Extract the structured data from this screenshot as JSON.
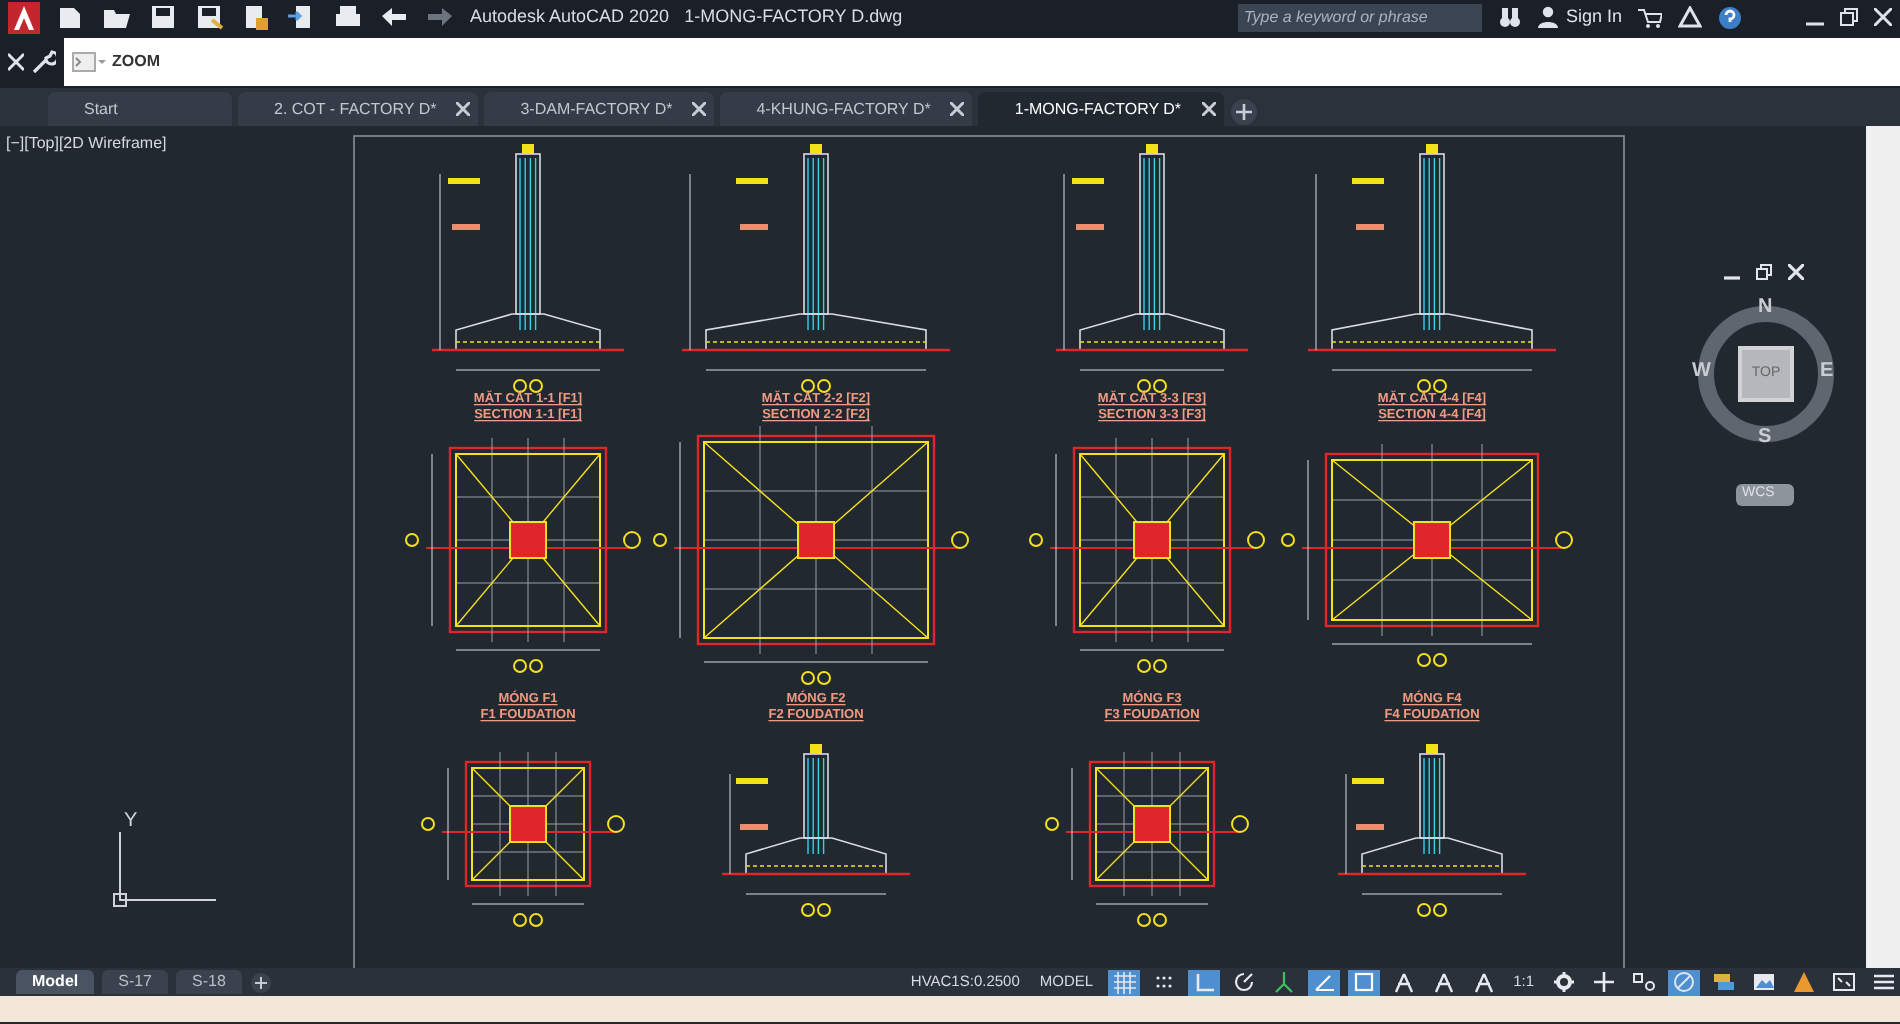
{
  "title_bar": {
    "app_name": "Autodesk AutoCAD 2020",
    "file_name": "1-MONG-FACTORY D.dwg",
    "search": {
      "placeholder": "Type a keyword or phrase"
    },
    "sign_in": "Sign In"
  },
  "command_line": {
    "value": "ZOOM"
  },
  "file_tabs": [
    {
      "label": "Start",
      "selected": false,
      "closable": false
    },
    {
      "label": "2. COT - FACTORY D*",
      "selected": false,
      "closable": true
    },
    {
      "label": "3-DAM-FACTORY D*",
      "selected": false,
      "closable": true
    },
    {
      "label": "4-KHUNG-FACTORY D*",
      "selected": false,
      "closable": true
    },
    {
      "label": "1-MONG-FACTORY D*",
      "selected": true,
      "closable": true
    }
  ],
  "viewport": {
    "label": "[−][Top][2D Wireframe]",
    "ucs_axis": "Y"
  },
  "viewcube": {
    "north": "N",
    "south": "S",
    "east": "E",
    "west": "W",
    "face": "TOP",
    "coordinate_system": "WCS"
  },
  "drawing": {
    "sections": [
      {
        "title": "MẶT CẮT 1-1 [F1]",
        "subtitle": "SECTION 1-1 [F1]"
      },
      {
        "title": "MẶT CẮT 2-2 [F2]",
        "subtitle": "SECTION 2-2 [F2]"
      },
      {
        "title": "MẶT CẮT 3-3 [F3]",
        "subtitle": "SECTION 3-3 [F3]"
      },
      {
        "title": "MẶT CẮT 4-4 [F4]",
        "subtitle": "SECTION 4-4 [F4]"
      }
    ],
    "foundations": [
      {
        "title": "MÓNG F1",
        "subtitle": "F1 FOUDATION"
      },
      {
        "title": "MÓNG F2",
        "subtitle": "F2 FOUDATION"
      },
      {
        "title": "MÓNG F3",
        "subtitle": "F3 FOUDATION"
      },
      {
        "title": "MÓNG F4",
        "subtitle": "F4 FOUDATION"
      }
    ],
    "bottom_row": [
      {
        "kind": "plan"
      },
      {
        "kind": "section"
      },
      {
        "kind": "plan"
      },
      {
        "kind": "section"
      }
    ]
  },
  "layout_tabs": [
    {
      "label": "Model",
      "selected": true
    },
    {
      "label": "S-17",
      "selected": false
    },
    {
      "label": "S-18",
      "selected": false
    }
  ],
  "status_bar": {
    "annotation_style": "HVAC1S:0.2500",
    "space": "MODEL",
    "scale": "1:1",
    "toggles": [
      {
        "kind": "grid",
        "on": true
      },
      {
        "kind": "snap",
        "on": false
      },
      {
        "kind": "ortho",
        "on": true
      },
      {
        "kind": "polar",
        "on": false
      },
      {
        "kind": "isodraft",
        "on": false
      },
      {
        "kind": "angle",
        "on": true
      },
      {
        "kind": "osnap",
        "on": true
      },
      {
        "kind": "annotation",
        "on": false
      },
      {
        "kind": "annotation",
        "on": false
      },
      {
        "kind": "annotation",
        "on": false
      }
    ],
    "tools": [
      {
        "kind": "gear",
        "on": false
      },
      {
        "kind": "plus",
        "on": false
      },
      {
        "kind": "hardware",
        "on": false
      },
      {
        "kind": "isolate",
        "on": true
      },
      {
        "kind": "layers",
        "on": false
      },
      {
        "kind": "picture",
        "on": false
      },
      {
        "kind": "warning",
        "on": false
      },
      {
        "kind": "fullscreen",
        "on": false
      },
      {
        "kind": "menu",
        "on": false
      }
    ]
  }
}
